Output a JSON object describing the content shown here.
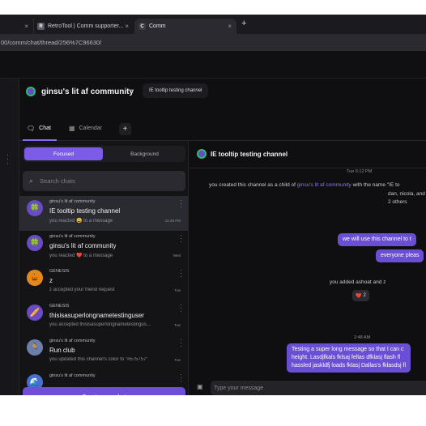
{
  "browser": {
    "tabs": [
      {
        "label": "",
        "close": "×"
      },
      {
        "label": "RetroTool | Comm supporter...",
        "close": "×",
        "icon": "retrotool-favicon"
      },
      {
        "label": "Comm",
        "close": "×",
        "icon": "comm-favicon"
      }
    ],
    "new_tab": "+",
    "url": "00/comm/chat/thread/256%7C96630/"
  },
  "community": {
    "name": "ginsu's lit af community",
    "chevron": "›",
    "channel_chip": "IE tooltip testing channel"
  },
  "nav": {
    "chat": "Chat",
    "calendar": "Calendar",
    "add": "+"
  },
  "sidebar": {
    "toggle_focused": "Focused",
    "toggle_background": "Background",
    "search_placeholder": "Search chats",
    "new_chat": "Create new chat",
    "items": [
      {
        "source": "ginsu's lit af community",
        "title": "IE tooltip testing channel",
        "preview": "you reacted 😃 to a message",
        "time": "12:48 PM",
        "avatar": "🍀",
        "avatar_bg": "#6a4bc4"
      },
      {
        "source": "ginsu's lit af community",
        "title": "ginsu's lit af community",
        "preview": "you reacted ❤️ to a message",
        "time": "Wed",
        "avatar": "🍀",
        "avatar_bg": "#6a4bc4"
      },
      {
        "source": "GENESIS",
        "title": "z",
        "preview": "z accepted your friend request",
        "time": "Tue",
        "avatar": "🎃",
        "avatar_bg": "#e08a1e"
      },
      {
        "source": "GENESIS",
        "title": "thisisasuperlongnametestinguser",
        "preview": "you accepted thisisasuperlongnametestingus...",
        "time": "Tue",
        "avatar": "🥖",
        "avatar_bg": "#6a4bc4"
      },
      {
        "source": "ginsu's lit af community",
        "title": "Run club",
        "preview": "you updated this channel's color to \"#575757\"",
        "time": "Tue",
        "avatar": "🏃",
        "avatar_bg": "#6b7fa8"
      },
      {
        "source": "ginsu's lit af community",
        "title": "",
        "preview": "",
        "time": "",
        "avatar": "🌊",
        "avatar_bg": "#4a6ed0"
      }
    ]
  },
  "thread": {
    "title": "IE tooltip testing channel",
    "stamp1": "Tue 6:12 PM",
    "sys1_prefix": "you created this channel as a child of ",
    "sys1_link": "ginsu's lit af community",
    "sys1_suffix": " with the name \"IE to",
    "sys1_line2": "dan, nicola, and 2 others",
    "bubble1": "we will use this channel to t",
    "bubble2": "everyone pleas",
    "sys2": "you added ashoat and z",
    "reaction_emoji": "❤️",
    "reaction_count": "2",
    "stamp2": "2:48 AM",
    "bubble3_l1": "Testing a super long message so that I can c",
    "bubble3_l2": "height. Lasdjfkals fklsaj fellas dfklasj flash fl",
    "bubble3_l3": "hassled jaskldfj loads fklasj Dallas's fklasdsj fl",
    "composer_placeholder": "Type your message"
  }
}
